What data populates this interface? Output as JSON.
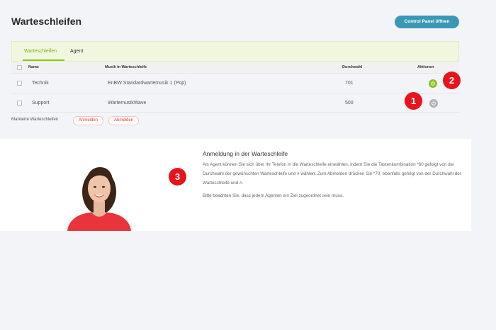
{
  "header": {
    "title": "Warteschleifen",
    "control_panel_button": "Control Panel öffnen"
  },
  "tabs": [
    {
      "label": "Warteschleifen",
      "active": true
    },
    {
      "label": "Agent",
      "active": false
    }
  ],
  "table": {
    "columns": [
      "Name",
      "Musik in Warteschleife",
      "Durchwahl",
      "Aktionen"
    ],
    "rows": [
      {
        "name": "Technik",
        "music": "EnBW Standardwartemusik 1 (Pop)",
        "extension": "701",
        "action_state": "active"
      },
      {
        "name": "Support",
        "music": "WartemusikWave",
        "extension": "500",
        "action_state": "inactive"
      }
    ]
  },
  "bulk_actions": {
    "label": "Markierte Warteschleifen",
    "login": "Anmelden",
    "logout": "Abmelden"
  },
  "info": {
    "title": "Anmeldung in der Warteschleife",
    "paragraph1": "Als Agent können Sie sich über Ihr Telefon in die Warteschleife einwählen, indem Sie die Tastenkombination *60 gefolgt von der Durchwahl der gewünschten Warteschleife und # wählen. Zum Abmelden drücken Sie *70, ebenfalls gefolgt von der Durchwahl der Warteschleife und #.",
    "paragraph2": "Bitte beachten Sie, dass jedem Agenten ein Ziel zugeordnet sein muss."
  },
  "markers": [
    "1",
    "2",
    "3"
  ],
  "colors": {
    "accent_green": "#8cc31f",
    "button_blue": "#3a98b5",
    "marker_red": "#e8141c",
    "pill_red": "#e33333"
  },
  "icons": {
    "action_button": "power-icon"
  }
}
